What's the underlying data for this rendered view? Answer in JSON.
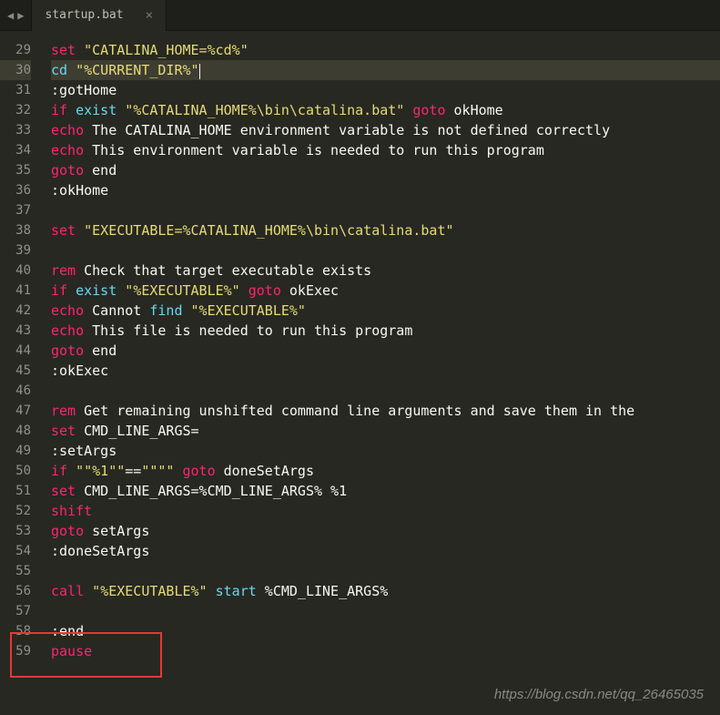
{
  "tab": {
    "filename": "startup.bat",
    "close": "×"
  },
  "nav": {
    "left": "◀",
    "right": "▶"
  },
  "lines": [
    {
      "n": 29,
      "cur": false,
      "tokens": [
        [
          "kw",
          "set"
        ],
        [
          "txt",
          " "
        ],
        [
          "str",
          "\"CATALINA_HOME=%cd%\""
        ]
      ]
    },
    {
      "n": 30,
      "cur": true,
      "tokens": [
        [
          "cmd",
          "cd"
        ],
        [
          "txt",
          " "
        ],
        [
          "str",
          "\"%CURRENT_DIR%\""
        ]
      ],
      "cursor": true
    },
    {
      "n": 31,
      "cur": false,
      "tokens": [
        [
          "lbl",
          ":gotHome"
        ]
      ]
    },
    {
      "n": 32,
      "cur": false,
      "tokens": [
        [
          "kw",
          "if"
        ],
        [
          "txt",
          " "
        ],
        [
          "cmd",
          "exist"
        ],
        [
          "txt",
          " "
        ],
        [
          "str",
          "\"%CATALINA_HOME%\\bin\\catalina.bat\""
        ],
        [
          "txt",
          " "
        ],
        [
          "kw",
          "goto"
        ],
        [
          "txt",
          " okHome"
        ]
      ]
    },
    {
      "n": 33,
      "cur": false,
      "tokens": [
        [
          "kw",
          "echo"
        ],
        [
          "txt",
          " The CATALINA_HOME environment variable is not defined correctly"
        ]
      ]
    },
    {
      "n": 34,
      "cur": false,
      "tokens": [
        [
          "kw",
          "echo"
        ],
        [
          "txt",
          " This environment variable is needed to run this program"
        ]
      ]
    },
    {
      "n": 35,
      "cur": false,
      "tokens": [
        [
          "kw",
          "goto"
        ],
        [
          "txt",
          " end"
        ]
      ]
    },
    {
      "n": 36,
      "cur": false,
      "tokens": [
        [
          "lbl",
          ":okHome"
        ]
      ]
    },
    {
      "n": 37,
      "cur": false,
      "tokens": []
    },
    {
      "n": 38,
      "cur": false,
      "tokens": [
        [
          "kw",
          "set"
        ],
        [
          "txt",
          " "
        ],
        [
          "str",
          "\"EXECUTABLE=%CATALINA_HOME%\\bin\\catalina.bat\""
        ]
      ]
    },
    {
      "n": 39,
      "cur": false,
      "tokens": []
    },
    {
      "n": 40,
      "cur": false,
      "tokens": [
        [
          "kw",
          "rem"
        ],
        [
          "txt",
          " Check that target executable exists"
        ]
      ]
    },
    {
      "n": 41,
      "cur": false,
      "tokens": [
        [
          "kw",
          "if"
        ],
        [
          "txt",
          " "
        ],
        [
          "cmd",
          "exist"
        ],
        [
          "txt",
          " "
        ],
        [
          "str",
          "\"%EXECUTABLE%\""
        ],
        [
          "txt",
          " "
        ],
        [
          "kw",
          "goto"
        ],
        [
          "txt",
          " okExec"
        ]
      ]
    },
    {
      "n": 42,
      "cur": false,
      "tokens": [
        [
          "kw",
          "echo"
        ],
        [
          "txt",
          " Cannot "
        ],
        [
          "cmd",
          "find"
        ],
        [
          "txt",
          " "
        ],
        [
          "str",
          "\"%EXECUTABLE%\""
        ]
      ]
    },
    {
      "n": 43,
      "cur": false,
      "tokens": [
        [
          "kw",
          "echo"
        ],
        [
          "txt",
          " This file is needed to run this program"
        ]
      ]
    },
    {
      "n": 44,
      "cur": false,
      "tokens": [
        [
          "kw",
          "goto"
        ],
        [
          "txt",
          " end"
        ]
      ]
    },
    {
      "n": 45,
      "cur": false,
      "tokens": [
        [
          "lbl",
          ":okExec"
        ]
      ]
    },
    {
      "n": 46,
      "cur": false,
      "tokens": []
    },
    {
      "n": 47,
      "cur": false,
      "tokens": [
        [
          "kw",
          "rem"
        ],
        [
          "txt",
          " Get remaining unshifted command line arguments and save them in the"
        ]
      ]
    },
    {
      "n": 48,
      "cur": false,
      "tokens": [
        [
          "kw",
          "set"
        ],
        [
          "txt",
          " CMD_LINE_ARGS="
        ]
      ]
    },
    {
      "n": 49,
      "cur": false,
      "tokens": [
        [
          "lbl",
          ":setArgs"
        ]
      ]
    },
    {
      "n": 50,
      "cur": false,
      "tokens": [
        [
          "kw",
          "if"
        ],
        [
          "txt",
          " "
        ],
        [
          "str",
          "\"\"%1\"\""
        ],
        [
          "txt",
          "=="
        ],
        [
          "str",
          "\"\"\"\""
        ],
        [
          "txt",
          " "
        ],
        [
          "kw",
          "goto"
        ],
        [
          "txt",
          " doneSetArgs"
        ]
      ]
    },
    {
      "n": 51,
      "cur": false,
      "tokens": [
        [
          "kw",
          "set"
        ],
        [
          "txt",
          " CMD_LINE_ARGS=%CMD_LINE_ARGS% %1"
        ]
      ]
    },
    {
      "n": 52,
      "cur": false,
      "tokens": [
        [
          "kw",
          "shift"
        ]
      ]
    },
    {
      "n": 53,
      "cur": false,
      "tokens": [
        [
          "kw",
          "goto"
        ],
        [
          "txt",
          " setArgs"
        ]
      ]
    },
    {
      "n": 54,
      "cur": false,
      "tokens": [
        [
          "lbl",
          ":doneSetArgs"
        ]
      ]
    },
    {
      "n": 55,
      "cur": false,
      "tokens": []
    },
    {
      "n": 56,
      "cur": false,
      "tokens": [
        [
          "kw",
          "call"
        ],
        [
          "txt",
          " "
        ],
        [
          "str",
          "\"%EXECUTABLE%\""
        ],
        [
          "txt",
          " "
        ],
        [
          "cmd",
          "start"
        ],
        [
          "txt",
          " %CMD_LINE_ARGS%"
        ]
      ]
    },
    {
      "n": 57,
      "cur": false,
      "tokens": []
    },
    {
      "n": 58,
      "cur": false,
      "tokens": [
        [
          "lbl",
          ":end"
        ]
      ]
    },
    {
      "n": 59,
      "cur": false,
      "tokens": [
        [
          "kw",
          "pause"
        ]
      ]
    }
  ],
  "watermark": "https://blog.csdn.net/qq_26465035"
}
